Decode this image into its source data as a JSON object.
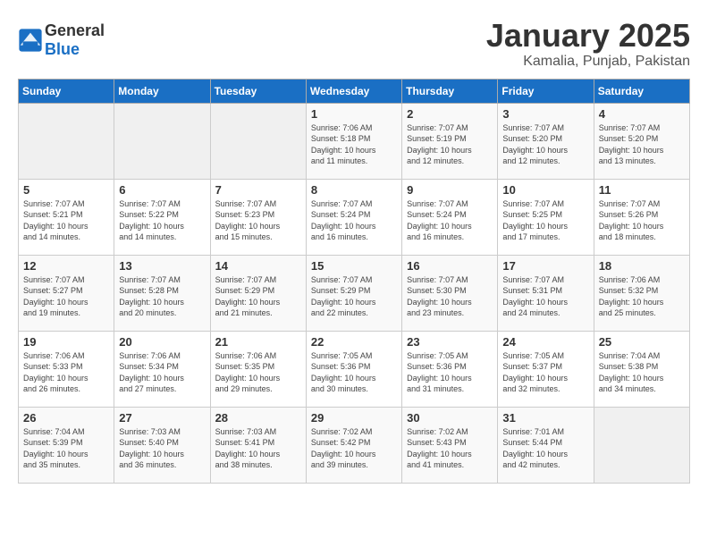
{
  "logo": {
    "general": "General",
    "blue": "Blue"
  },
  "title": "January 2025",
  "subtitle": "Kamalia, Punjab, Pakistan",
  "headers": [
    "Sunday",
    "Monday",
    "Tuesday",
    "Wednesday",
    "Thursday",
    "Friday",
    "Saturday"
  ],
  "weeks": [
    [
      {
        "day": "",
        "info": ""
      },
      {
        "day": "",
        "info": ""
      },
      {
        "day": "",
        "info": ""
      },
      {
        "day": "1",
        "info": "Sunrise: 7:06 AM\nSunset: 5:18 PM\nDaylight: 10 hours\nand 11 minutes."
      },
      {
        "day": "2",
        "info": "Sunrise: 7:07 AM\nSunset: 5:19 PM\nDaylight: 10 hours\nand 12 minutes."
      },
      {
        "day": "3",
        "info": "Sunrise: 7:07 AM\nSunset: 5:20 PM\nDaylight: 10 hours\nand 12 minutes."
      },
      {
        "day": "4",
        "info": "Sunrise: 7:07 AM\nSunset: 5:20 PM\nDaylight: 10 hours\nand 13 minutes."
      }
    ],
    [
      {
        "day": "5",
        "info": "Sunrise: 7:07 AM\nSunset: 5:21 PM\nDaylight: 10 hours\nand 14 minutes."
      },
      {
        "day": "6",
        "info": "Sunrise: 7:07 AM\nSunset: 5:22 PM\nDaylight: 10 hours\nand 14 minutes."
      },
      {
        "day": "7",
        "info": "Sunrise: 7:07 AM\nSunset: 5:23 PM\nDaylight: 10 hours\nand 15 minutes."
      },
      {
        "day": "8",
        "info": "Sunrise: 7:07 AM\nSunset: 5:24 PM\nDaylight: 10 hours\nand 16 minutes."
      },
      {
        "day": "9",
        "info": "Sunrise: 7:07 AM\nSunset: 5:24 PM\nDaylight: 10 hours\nand 16 minutes."
      },
      {
        "day": "10",
        "info": "Sunrise: 7:07 AM\nSunset: 5:25 PM\nDaylight: 10 hours\nand 17 minutes."
      },
      {
        "day": "11",
        "info": "Sunrise: 7:07 AM\nSunset: 5:26 PM\nDaylight: 10 hours\nand 18 minutes."
      }
    ],
    [
      {
        "day": "12",
        "info": "Sunrise: 7:07 AM\nSunset: 5:27 PM\nDaylight: 10 hours\nand 19 minutes."
      },
      {
        "day": "13",
        "info": "Sunrise: 7:07 AM\nSunset: 5:28 PM\nDaylight: 10 hours\nand 20 minutes."
      },
      {
        "day": "14",
        "info": "Sunrise: 7:07 AM\nSunset: 5:29 PM\nDaylight: 10 hours\nand 21 minutes."
      },
      {
        "day": "15",
        "info": "Sunrise: 7:07 AM\nSunset: 5:29 PM\nDaylight: 10 hours\nand 22 minutes."
      },
      {
        "day": "16",
        "info": "Sunrise: 7:07 AM\nSunset: 5:30 PM\nDaylight: 10 hours\nand 23 minutes."
      },
      {
        "day": "17",
        "info": "Sunrise: 7:07 AM\nSunset: 5:31 PM\nDaylight: 10 hours\nand 24 minutes."
      },
      {
        "day": "18",
        "info": "Sunrise: 7:06 AM\nSunset: 5:32 PM\nDaylight: 10 hours\nand 25 minutes."
      }
    ],
    [
      {
        "day": "19",
        "info": "Sunrise: 7:06 AM\nSunset: 5:33 PM\nDaylight: 10 hours\nand 26 minutes."
      },
      {
        "day": "20",
        "info": "Sunrise: 7:06 AM\nSunset: 5:34 PM\nDaylight: 10 hours\nand 27 minutes."
      },
      {
        "day": "21",
        "info": "Sunrise: 7:06 AM\nSunset: 5:35 PM\nDaylight: 10 hours\nand 29 minutes."
      },
      {
        "day": "22",
        "info": "Sunrise: 7:05 AM\nSunset: 5:36 PM\nDaylight: 10 hours\nand 30 minutes."
      },
      {
        "day": "23",
        "info": "Sunrise: 7:05 AM\nSunset: 5:36 PM\nDaylight: 10 hours\nand 31 minutes."
      },
      {
        "day": "24",
        "info": "Sunrise: 7:05 AM\nSunset: 5:37 PM\nDaylight: 10 hours\nand 32 minutes."
      },
      {
        "day": "25",
        "info": "Sunrise: 7:04 AM\nSunset: 5:38 PM\nDaylight: 10 hours\nand 34 minutes."
      }
    ],
    [
      {
        "day": "26",
        "info": "Sunrise: 7:04 AM\nSunset: 5:39 PM\nDaylight: 10 hours\nand 35 minutes."
      },
      {
        "day": "27",
        "info": "Sunrise: 7:03 AM\nSunset: 5:40 PM\nDaylight: 10 hours\nand 36 minutes."
      },
      {
        "day": "28",
        "info": "Sunrise: 7:03 AM\nSunset: 5:41 PM\nDaylight: 10 hours\nand 38 minutes."
      },
      {
        "day": "29",
        "info": "Sunrise: 7:02 AM\nSunset: 5:42 PM\nDaylight: 10 hours\nand 39 minutes."
      },
      {
        "day": "30",
        "info": "Sunrise: 7:02 AM\nSunset: 5:43 PM\nDaylight: 10 hours\nand 41 minutes."
      },
      {
        "day": "31",
        "info": "Sunrise: 7:01 AM\nSunset: 5:44 PM\nDaylight: 10 hours\nand 42 minutes."
      },
      {
        "day": "",
        "info": ""
      }
    ]
  ]
}
